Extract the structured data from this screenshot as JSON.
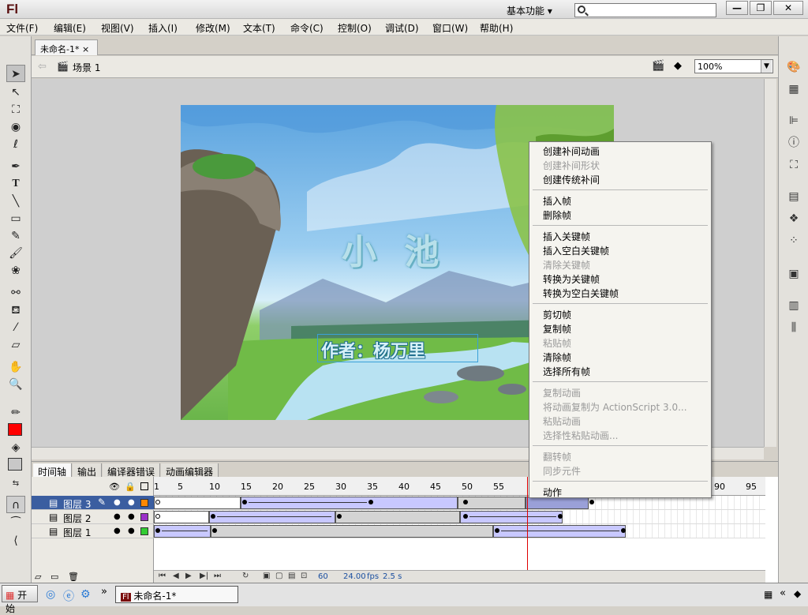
{
  "app": {
    "logo": "Fl",
    "workspace": "基本功能",
    "search_placeholder": "",
    "win_buttons": {
      "min": "—",
      "restore": "❐",
      "close": "✕"
    }
  },
  "menubar": [
    "文件(F)",
    "编辑(E)",
    "视图(V)",
    "插入(I)",
    "修改(M)",
    "文本(T)",
    "命令(C)",
    "控制(O)",
    "调试(D)",
    "窗口(W)",
    "帮助(H)"
  ],
  "document": {
    "tab": "未命名-1*",
    "tab_close": "×",
    "scene": "场景 1",
    "zoom": "100%"
  },
  "stage": {
    "title": "小  池",
    "subtitle": "作者：杨万里"
  },
  "timeline": {
    "tabs": [
      "时间轴",
      "输出",
      "编译器错误",
      "动画编辑器"
    ],
    "layers": [
      {
        "name": "图层 3",
        "color": "#ff8800",
        "selected": true
      },
      {
        "name": "图层 2",
        "color": "#9b30c8",
        "selected": false
      },
      {
        "name": "图层 1",
        "color": "#33cc33",
        "selected": false
      }
    ],
    "ruler": [
      "1",
      "5",
      "10",
      "15",
      "20",
      "25",
      "30",
      "35",
      "40",
      "45",
      "50",
      "55",
      "90",
      "95"
    ],
    "footer": {
      "frame": "60",
      "fps": "24.00",
      "fps_unit": "fps",
      "time": "2.5 s"
    }
  },
  "context_menu": {
    "groups": [
      [
        {
          "label": "创建补间动画",
          "enabled": true
        },
        {
          "label": "创建补间形状",
          "enabled": false
        },
        {
          "label": "创建传统补间",
          "enabled": true
        }
      ],
      [
        {
          "label": "插入帧",
          "enabled": true
        },
        {
          "label": "删除帧",
          "enabled": true
        }
      ],
      [
        {
          "label": "插入关键帧",
          "enabled": true
        },
        {
          "label": "插入空白关键帧",
          "enabled": true
        },
        {
          "label": "清除关键帧",
          "enabled": false
        },
        {
          "label": "转换为关键帧",
          "enabled": true
        },
        {
          "label": "转换为空白关键帧",
          "enabled": true
        }
      ],
      [
        {
          "label": "剪切帧",
          "enabled": true
        },
        {
          "label": "复制帧",
          "enabled": true
        },
        {
          "label": "粘贴帧",
          "enabled": false
        },
        {
          "label": "清除帧",
          "enabled": true
        },
        {
          "label": "选择所有帧",
          "enabled": true
        }
      ],
      [
        {
          "label": "复制动画",
          "enabled": false
        },
        {
          "label": "将动画复制为 ActionScript 3.0...",
          "enabled": false
        },
        {
          "label": "粘贴动画",
          "enabled": false
        },
        {
          "label": "选择性粘贴动画...",
          "enabled": false
        }
      ],
      [
        {
          "label": "翻转帧",
          "enabled": false
        },
        {
          "label": "同步元件",
          "enabled": false
        }
      ],
      [
        {
          "label": "动作",
          "enabled": true
        }
      ]
    ]
  },
  "taskbar": {
    "start": "开始",
    "item": "未命名-1*",
    "overflow": "»"
  }
}
